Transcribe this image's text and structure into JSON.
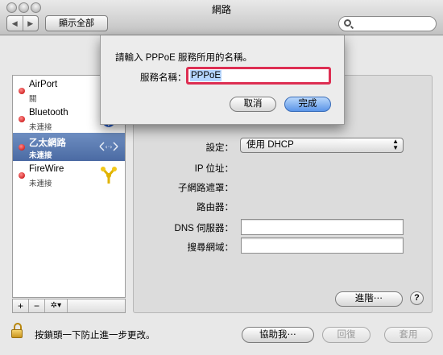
{
  "window": {
    "title": "網路"
  },
  "toolbar": {
    "back": "◀",
    "forward": "▶",
    "show_all": "顯示全部",
    "search_placeholder": ""
  },
  "sidebar": {
    "services": [
      {
        "name": "AirPort",
        "status": "關",
        "status_color": "#c00000",
        "icon": "wifi-icon"
      },
      {
        "name": "Bluetooth",
        "status": "未連接",
        "status_color": "#c00000",
        "icon": "bluetooth-icon"
      },
      {
        "name": "乙太網路",
        "status": "未連接",
        "status_color": "#c00000",
        "icon": "ethernet-icon",
        "selected": true
      },
      {
        "name": "FireWire",
        "status": "未連接",
        "status_color": "#c00000",
        "icon": "firewire-icon"
      }
    ],
    "tools": {
      "add": "+",
      "remove": "−",
      "gear": "✲▾"
    }
  },
  "detail": {
    "configure_label": "設定：",
    "configure_value": "使用 DHCP",
    "ip_label": "IP 位址：",
    "subnet_label": "子網路遮罩：",
    "router_label": "路由器：",
    "dns_label": "DNS 伺服器：",
    "search_domains_label": "搜尋網域：",
    "advanced_button": "進階⋯",
    "help_button": "?"
  },
  "footer": {
    "lock_text": "按鎖頭一下防止進一步更改。",
    "assist_button": "協助我⋯",
    "revert_button": "回復",
    "apply_button": "套用"
  },
  "sheet": {
    "prompt": "請輸入 PPPoE 服務所用的名稱。",
    "service_name_label": "服務名稱：",
    "service_name_value": "PPPoE",
    "cancel_button": "取消",
    "done_button": "完成"
  },
  "colors": {
    "selection": "#5578b0",
    "status_dot": "#c00000",
    "focus_ring": "#dd2e52",
    "default_button": "#5b95e8"
  }
}
